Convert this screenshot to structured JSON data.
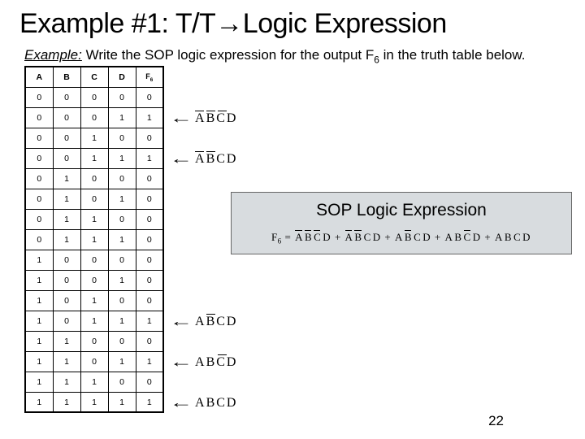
{
  "title": "Example #1: T/T→Logic Expression",
  "subtitle": {
    "label": "Example:",
    "text_a": " Write the SOP logic expression for the output F",
    "text_sub": "6",
    "text_b": " in the truth table below."
  },
  "truth_table": {
    "headers": [
      "A",
      "B",
      "C",
      "D",
      "F6"
    ],
    "rows": [
      [
        "0",
        "0",
        "0",
        "0",
        "0"
      ],
      [
        "0",
        "0",
        "0",
        "1",
        "1"
      ],
      [
        "0",
        "0",
        "1",
        "0",
        "0"
      ],
      [
        "0",
        "0",
        "1",
        "1",
        "1"
      ],
      [
        "0",
        "1",
        "0",
        "0",
        "0"
      ],
      [
        "0",
        "1",
        "0",
        "1",
        "0"
      ],
      [
        "0",
        "1",
        "1",
        "0",
        "0"
      ],
      [
        "0",
        "1",
        "1",
        "1",
        "0"
      ],
      [
        "1",
        "0",
        "0",
        "0",
        "0"
      ],
      [
        "1",
        "0",
        "0",
        "1",
        "0"
      ],
      [
        "1",
        "0",
        "1",
        "0",
        "0"
      ],
      [
        "1",
        "0",
        "1",
        "1",
        "1"
      ],
      [
        "1",
        "1",
        "0",
        "0",
        "0"
      ],
      [
        "1",
        "1",
        "0",
        "1",
        "1"
      ],
      [
        "1",
        "1",
        "1",
        "0",
        "0"
      ],
      [
        "1",
        "1",
        "1",
        "1",
        "1"
      ]
    ]
  },
  "minterms": [
    {
      "row": 1,
      "bars": [
        true,
        true,
        true,
        false
      ],
      "vars": [
        "A",
        "B",
        "C",
        "D"
      ]
    },
    {
      "row": 3,
      "bars": [
        true,
        true,
        false,
        false
      ],
      "vars": [
        "A",
        "B",
        "C",
        "D"
      ]
    },
    {
      "row": 11,
      "bars": [
        false,
        true,
        false,
        false
      ],
      "vars": [
        "A",
        "B",
        "C",
        "D"
      ]
    },
    {
      "row": 13,
      "bars": [
        false,
        false,
        true,
        false
      ],
      "vars": [
        "A",
        "B",
        "C",
        "D"
      ]
    },
    {
      "row": 15,
      "bars": [
        false,
        false,
        false,
        false
      ],
      "vars": [
        "A",
        "B",
        "C",
        "D"
      ]
    }
  ],
  "sop": {
    "title": "SOP Logic Expression",
    "lhs": "F",
    "lhs_sub": "6",
    "eq": " = ",
    "terms": [
      [
        [
          true,
          "A"
        ],
        [
          true,
          "B"
        ],
        [
          true,
          "C"
        ],
        [
          false,
          "D"
        ]
      ],
      [
        [
          true,
          "A"
        ],
        [
          true,
          "B"
        ],
        [
          false,
          "C"
        ],
        [
          false,
          "D"
        ]
      ],
      [
        [
          false,
          "A"
        ],
        [
          true,
          "B"
        ],
        [
          false,
          "C"
        ],
        [
          false,
          "D"
        ]
      ],
      [
        [
          false,
          "A"
        ],
        [
          false,
          "B"
        ],
        [
          true,
          "C"
        ],
        [
          false,
          "D"
        ]
      ],
      [
        [
          false,
          "A"
        ],
        [
          false,
          "B"
        ],
        [
          false,
          "C"
        ],
        [
          false,
          "D"
        ]
      ]
    ],
    "plus": " + "
  },
  "pagenum": "22",
  "chart_data": {
    "type": "table",
    "title": "Truth table for F6",
    "columns": [
      "A",
      "B",
      "C",
      "D",
      "F6"
    ],
    "rows": [
      [
        0,
        0,
        0,
        0,
        0
      ],
      [
        0,
        0,
        0,
        1,
        1
      ],
      [
        0,
        0,
        1,
        0,
        0
      ],
      [
        0,
        0,
        1,
        1,
        1
      ],
      [
        0,
        1,
        0,
        0,
        0
      ],
      [
        0,
        1,
        0,
        1,
        0
      ],
      [
        0,
        1,
        1,
        0,
        0
      ],
      [
        0,
        1,
        1,
        1,
        0
      ],
      [
        1,
        0,
        0,
        0,
        0
      ],
      [
        1,
        0,
        0,
        1,
        0
      ],
      [
        1,
        0,
        1,
        0,
        0
      ],
      [
        1,
        0,
        1,
        1,
        1
      ],
      [
        1,
        1,
        0,
        0,
        0
      ],
      [
        1,
        1,
        0,
        1,
        1
      ],
      [
        1,
        1,
        1,
        0,
        0
      ],
      [
        1,
        1,
        1,
        1,
        1
      ]
    ]
  }
}
